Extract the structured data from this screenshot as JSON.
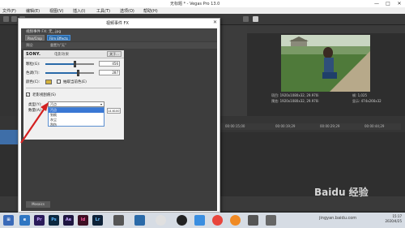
{
  "window": {
    "title": "无标题 * - Vegas Pro 13.0",
    "controls": [
      "—",
      "□",
      "✕"
    ]
  },
  "menu": [
    "文件(F)",
    "编辑(E)",
    "视图(V)",
    "插入(I)",
    "工具(T)",
    "选项(O)",
    "帮助(H)"
  ],
  "dialog": {
    "title": "视频事件 FX",
    "chain_label": "视频事件 FX: 无_.jpg",
    "chain_buttons": [
      "Pan/Crop",
      "Film Effects"
    ],
    "preset_label": "预设:",
    "preset_value": "重置为\"无\"",
    "plugin": {
      "brand": "SONY.",
      "name": "电影效果",
      "about": "关于..."
    },
    "params": {
      "brightness_label": "颗粒(G):",
      "brightness_value": "456",
      "sepia_label": "色调(T):",
      "sepia_value": "287",
      "color_label": "颜色(C):",
      "flicker_label": "抽取当前色(E)",
      "noise_label": "老影视刮痕(S)",
      "style_label": "类型(Y):",
      "style_value": "污点",
      "amount_label": "数量(A):",
      "amount_value": "14.6100"
    },
    "style_options": [
      "污点",
      "划痕",
      "灰尘",
      "刮伤"
    ],
    "style_selected_index": 0,
    "bottom_tab": "Mosaics"
  },
  "preview": {
    "info": [
      "项目: 1920x1080x32, 29.970i",
      "预览: 1920x1080x32, 29.970i",
      "帧: 1,025",
      "显示: 474x266x32"
    ]
  },
  "ruler": [
    "00:00:15;00",
    "00:00:19;29",
    "00:00:29;29",
    "00:00:44;29"
  ],
  "taskbar": {
    "apps": [
      "e",
      "Pr",
      "Ps",
      "Ae",
      "Id",
      "Lr",
      "",
      "",
      "",
      "",
      "",
      ""
    ],
    "time": "15:17",
    "date": "2020/4/25"
  },
  "watermark": {
    "text": "Baidu 经验",
    "url": "jingyan.baidu.com"
  },
  "colors": {
    "accent": "#2a6aa8",
    "selection": "#3a78d4",
    "annotation_arrow": "#d32020"
  }
}
